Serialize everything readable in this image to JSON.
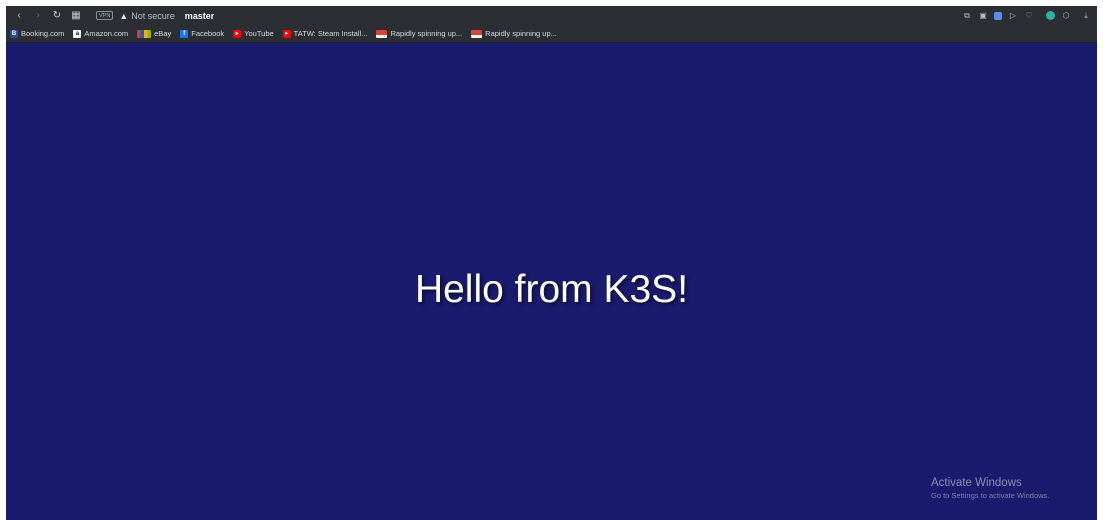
{
  "toolbar": {
    "vpn_label": "VPN",
    "security_text": "Not secure",
    "host": "master"
  },
  "bookmarks": [
    {
      "label": "Booking.com",
      "color": "#1f4fa8",
      "glyph": "B"
    },
    {
      "label": "Amazon.com",
      "color": "#ffffff",
      "glyph": "a"
    },
    {
      "label": "eBay",
      "color": "#e53238",
      "glyph": "e"
    },
    {
      "label": "Facebook",
      "color": "#1877f2",
      "glyph": "f"
    },
    {
      "label": "YouTube",
      "color": "#ff0000",
      "glyph": "▶"
    },
    {
      "label": "TATW: Steam Install...",
      "color": "#ff0000",
      "glyph": "▶"
    },
    {
      "label": "Rapidly spinning up...",
      "color": "#d9423a",
      "glyph": ""
    },
    {
      "label": "Rapidly spinning up...",
      "color": "#d9423a",
      "glyph": ""
    }
  ],
  "page": {
    "heading": "Hello from K3S!",
    "background": "#1a1a6e"
  },
  "watermark": {
    "title": "Activate Windows",
    "subtitle": "Go to Settings to activate Windows."
  }
}
